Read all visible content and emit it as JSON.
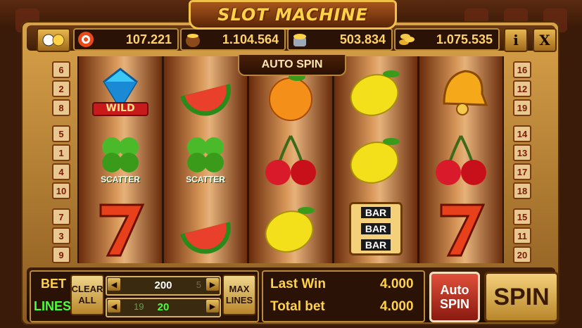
{
  "title": "SLOT MACHINE",
  "stats": [
    {
      "icon": "chip-icon",
      "value": "107.221"
    },
    {
      "icon": "coin-pot-icon",
      "value": "1.104.564"
    },
    {
      "icon": "coin-bucket-icon",
      "value": "503.834"
    },
    {
      "icon": "coin-stack-icon",
      "value": "1.075.535"
    }
  ],
  "buttons": {
    "info": "i",
    "close": "X"
  },
  "reels_header": "AUTO SPIN",
  "left_lines": [
    "6",
    "2",
    "8",
    "5",
    "1",
    "4",
    "10",
    "7",
    "3",
    "9"
  ],
  "right_lines": [
    "16",
    "12",
    "19",
    "14",
    "13",
    "17",
    "18",
    "15",
    "11",
    "20"
  ],
  "reels": [
    [
      {
        "name": "wild-diamond-icon",
        "label": "WILD"
      },
      {
        "name": "clover-scatter-icon",
        "label": "SCATTER"
      },
      {
        "name": "seven-icon",
        "label": ""
      }
    ],
    [
      {
        "name": "watermelon-icon",
        "label": ""
      },
      {
        "name": "clover-scatter-icon",
        "label": "SCATTER"
      },
      {
        "name": "watermelon-icon",
        "label": ""
      }
    ],
    [
      {
        "name": "orange-icon",
        "label": ""
      },
      {
        "name": "cherry-icon",
        "label": ""
      },
      {
        "name": "lemon-icon",
        "label": ""
      }
    ],
    [
      {
        "name": "lemon-icon",
        "label": ""
      },
      {
        "name": "lemon-icon",
        "label": ""
      },
      {
        "name": "triple-bar-icon",
        "label": "BAR"
      }
    ],
    [
      {
        "name": "bell-icon",
        "label": ""
      },
      {
        "name": "cherry-icon",
        "label": ""
      },
      {
        "name": "seven-icon",
        "label": ""
      }
    ]
  ],
  "bottom": {
    "bet_label": "BET",
    "lines_label": "LINES",
    "clear_all": "CLEAR ALL",
    "bet_value": "200",
    "bet_hint": "5",
    "lines_hint": "19",
    "lines_value": "20",
    "max_lines": "MAX LINES",
    "last_win_label": "Last Win",
    "last_win_value": "4.000",
    "total_bet_label": "Total bet",
    "total_bet_value": "4.000",
    "auto_spin_top": "Auto",
    "auto_spin_bottom": "SPIN",
    "spin": "SPIN"
  },
  "colors": {
    "gold": "#ffd24a",
    "green": "#4cff3a",
    "red": "#d83a2a"
  }
}
